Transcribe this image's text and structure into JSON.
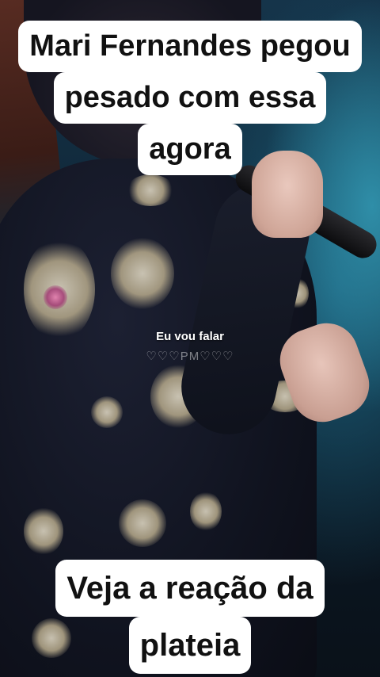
{
  "top_caption": {
    "line1": "Mari Fernandes pegou",
    "line2": "pesado com essa",
    "line3": "agora"
  },
  "lyric_text": "Eu vou falar",
  "watermark_text": "♡♡♡PM♡♡♡",
  "bottom_caption": {
    "line1": "Veja a reação da",
    "line2": "plateia"
  },
  "colors": {
    "caption_bg": "#ffffff",
    "caption_text": "#111111",
    "stage_light": "#2f8ea8"
  }
}
